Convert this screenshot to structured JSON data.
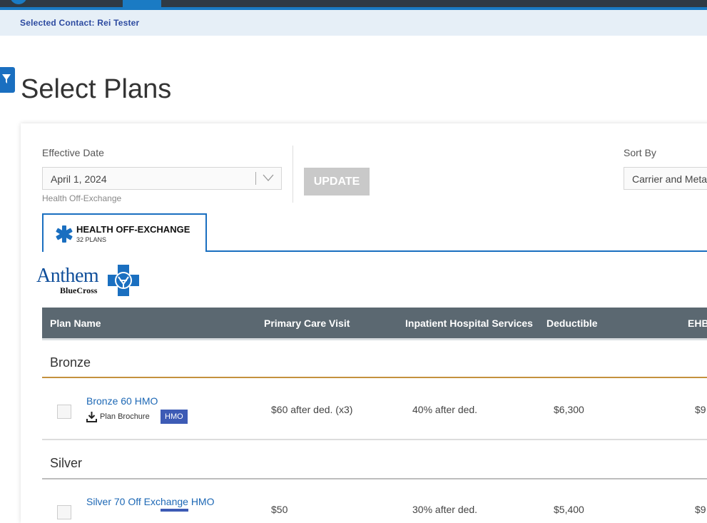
{
  "context": {
    "selected_contact": "Selected Contact: Rei Tester"
  },
  "page": {
    "title": "Select Plans"
  },
  "filters": {
    "effective_date_label": "Effective Date",
    "effective_date_value": "April 1, 2024",
    "effective_date_hint": "Health Off-Exchange",
    "update_label": "UPDATE",
    "sort_label": "Sort By",
    "sort_value": "Carrier and Metal"
  },
  "tab": {
    "title": "HEALTH OFF-EXCHANGE",
    "subtitle": "32 PLANS"
  },
  "carrier": {
    "name": "Anthem",
    "sub": "BlueCross"
  },
  "table": {
    "headers": [
      "Plan Name",
      "Primary Care Visit",
      "Inpatient Hospital Services",
      "Deductible",
      "EHB"
    ]
  },
  "groups": [
    {
      "name": "Bronze",
      "plans": [
        {
          "name": "Bronze 60 HMO",
          "brochure": "Plan Brochure",
          "badge": "HMO",
          "primary_care": "$60 after ded. (x3)",
          "inpatient": "40% after ded.",
          "deductible": "$6,300",
          "ehb": "$9"
        }
      ]
    },
    {
      "name": "Silver",
      "plans": [
        {
          "name": "Silver 70 Off Exchange HMO",
          "primary_care": "$50",
          "inpatient": "30% after ded.",
          "deductible": "$5,400",
          "ehb": "$9"
        }
      ]
    }
  ],
  "colors": {
    "accent": "#1a6fc0",
    "bronze_rule": "#c4913e",
    "header_bg": "#5b6871",
    "badge": "#3d5bb5"
  }
}
